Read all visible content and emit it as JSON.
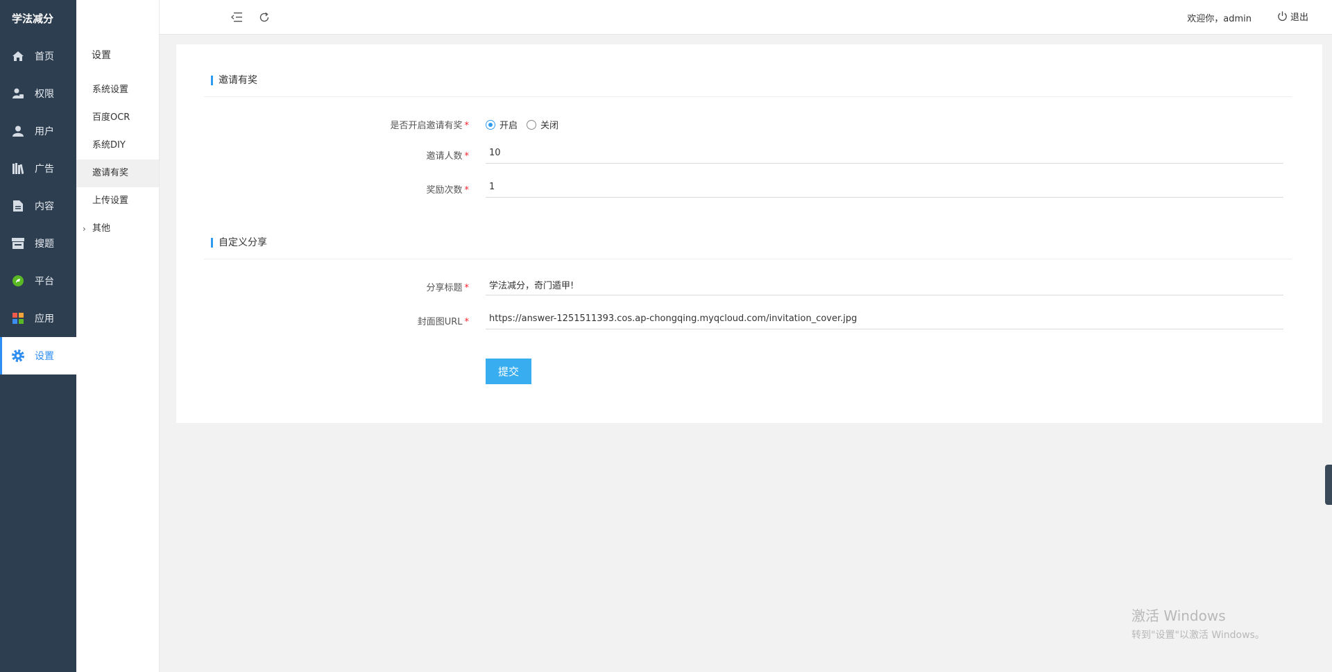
{
  "app": {
    "title": "学法减分"
  },
  "sidebar": {
    "items": [
      {
        "label": "首页",
        "icon": "home-icon"
      },
      {
        "label": "权限",
        "icon": "user-lock-icon"
      },
      {
        "label": "用户",
        "icon": "user-icon"
      },
      {
        "label": "广告",
        "icon": "books-icon"
      },
      {
        "label": "内容",
        "icon": "document-icon"
      },
      {
        "label": "搜题",
        "icon": "store-icon"
      },
      {
        "label": "平台",
        "icon": "platform-icon"
      },
      {
        "label": "应用",
        "icon": "apps-icon"
      },
      {
        "label": "设置",
        "icon": "gear-icon",
        "active": true
      }
    ]
  },
  "submenu": {
    "title": "设置",
    "items": [
      {
        "label": "系统设置"
      },
      {
        "label": "百度OCR"
      },
      {
        "label": "系统DIY"
      },
      {
        "label": "邀请有奖",
        "active": true
      },
      {
        "label": "上传设置"
      },
      {
        "label": "其他",
        "expandable": true
      }
    ]
  },
  "header": {
    "welcome": "欢迎你，admin",
    "logout": "退出"
  },
  "form": {
    "section1_title": "邀请有奖",
    "enable_label": "是否开启邀请有奖",
    "enable_options": [
      "开启",
      "关闭"
    ],
    "enable_selected": "开启",
    "invite_count_label": "邀请人数",
    "invite_count_value": "10",
    "reward_times_label": "奖励次数",
    "reward_times_value": "1",
    "section2_title": "自定义分享",
    "share_title_label": "分享标题",
    "share_title_value": "学法减分，奇门遁甲!",
    "cover_url_label": "封面图URL",
    "cover_url_value": "https://answer-1251511393.cos.ap-chongqing.myqcloud.com/invitation_cover.jpg",
    "required_mark": "*",
    "submit_label": "提交"
  },
  "watermark": {
    "line1": "激活 Windows",
    "line2": "转到\"设置\"以激活 Windows。"
  },
  "colors": {
    "sidebar_bg": "#2e3e51",
    "accent": "#2f8ef2",
    "button": "#38aef0",
    "required": "#f5222d"
  }
}
